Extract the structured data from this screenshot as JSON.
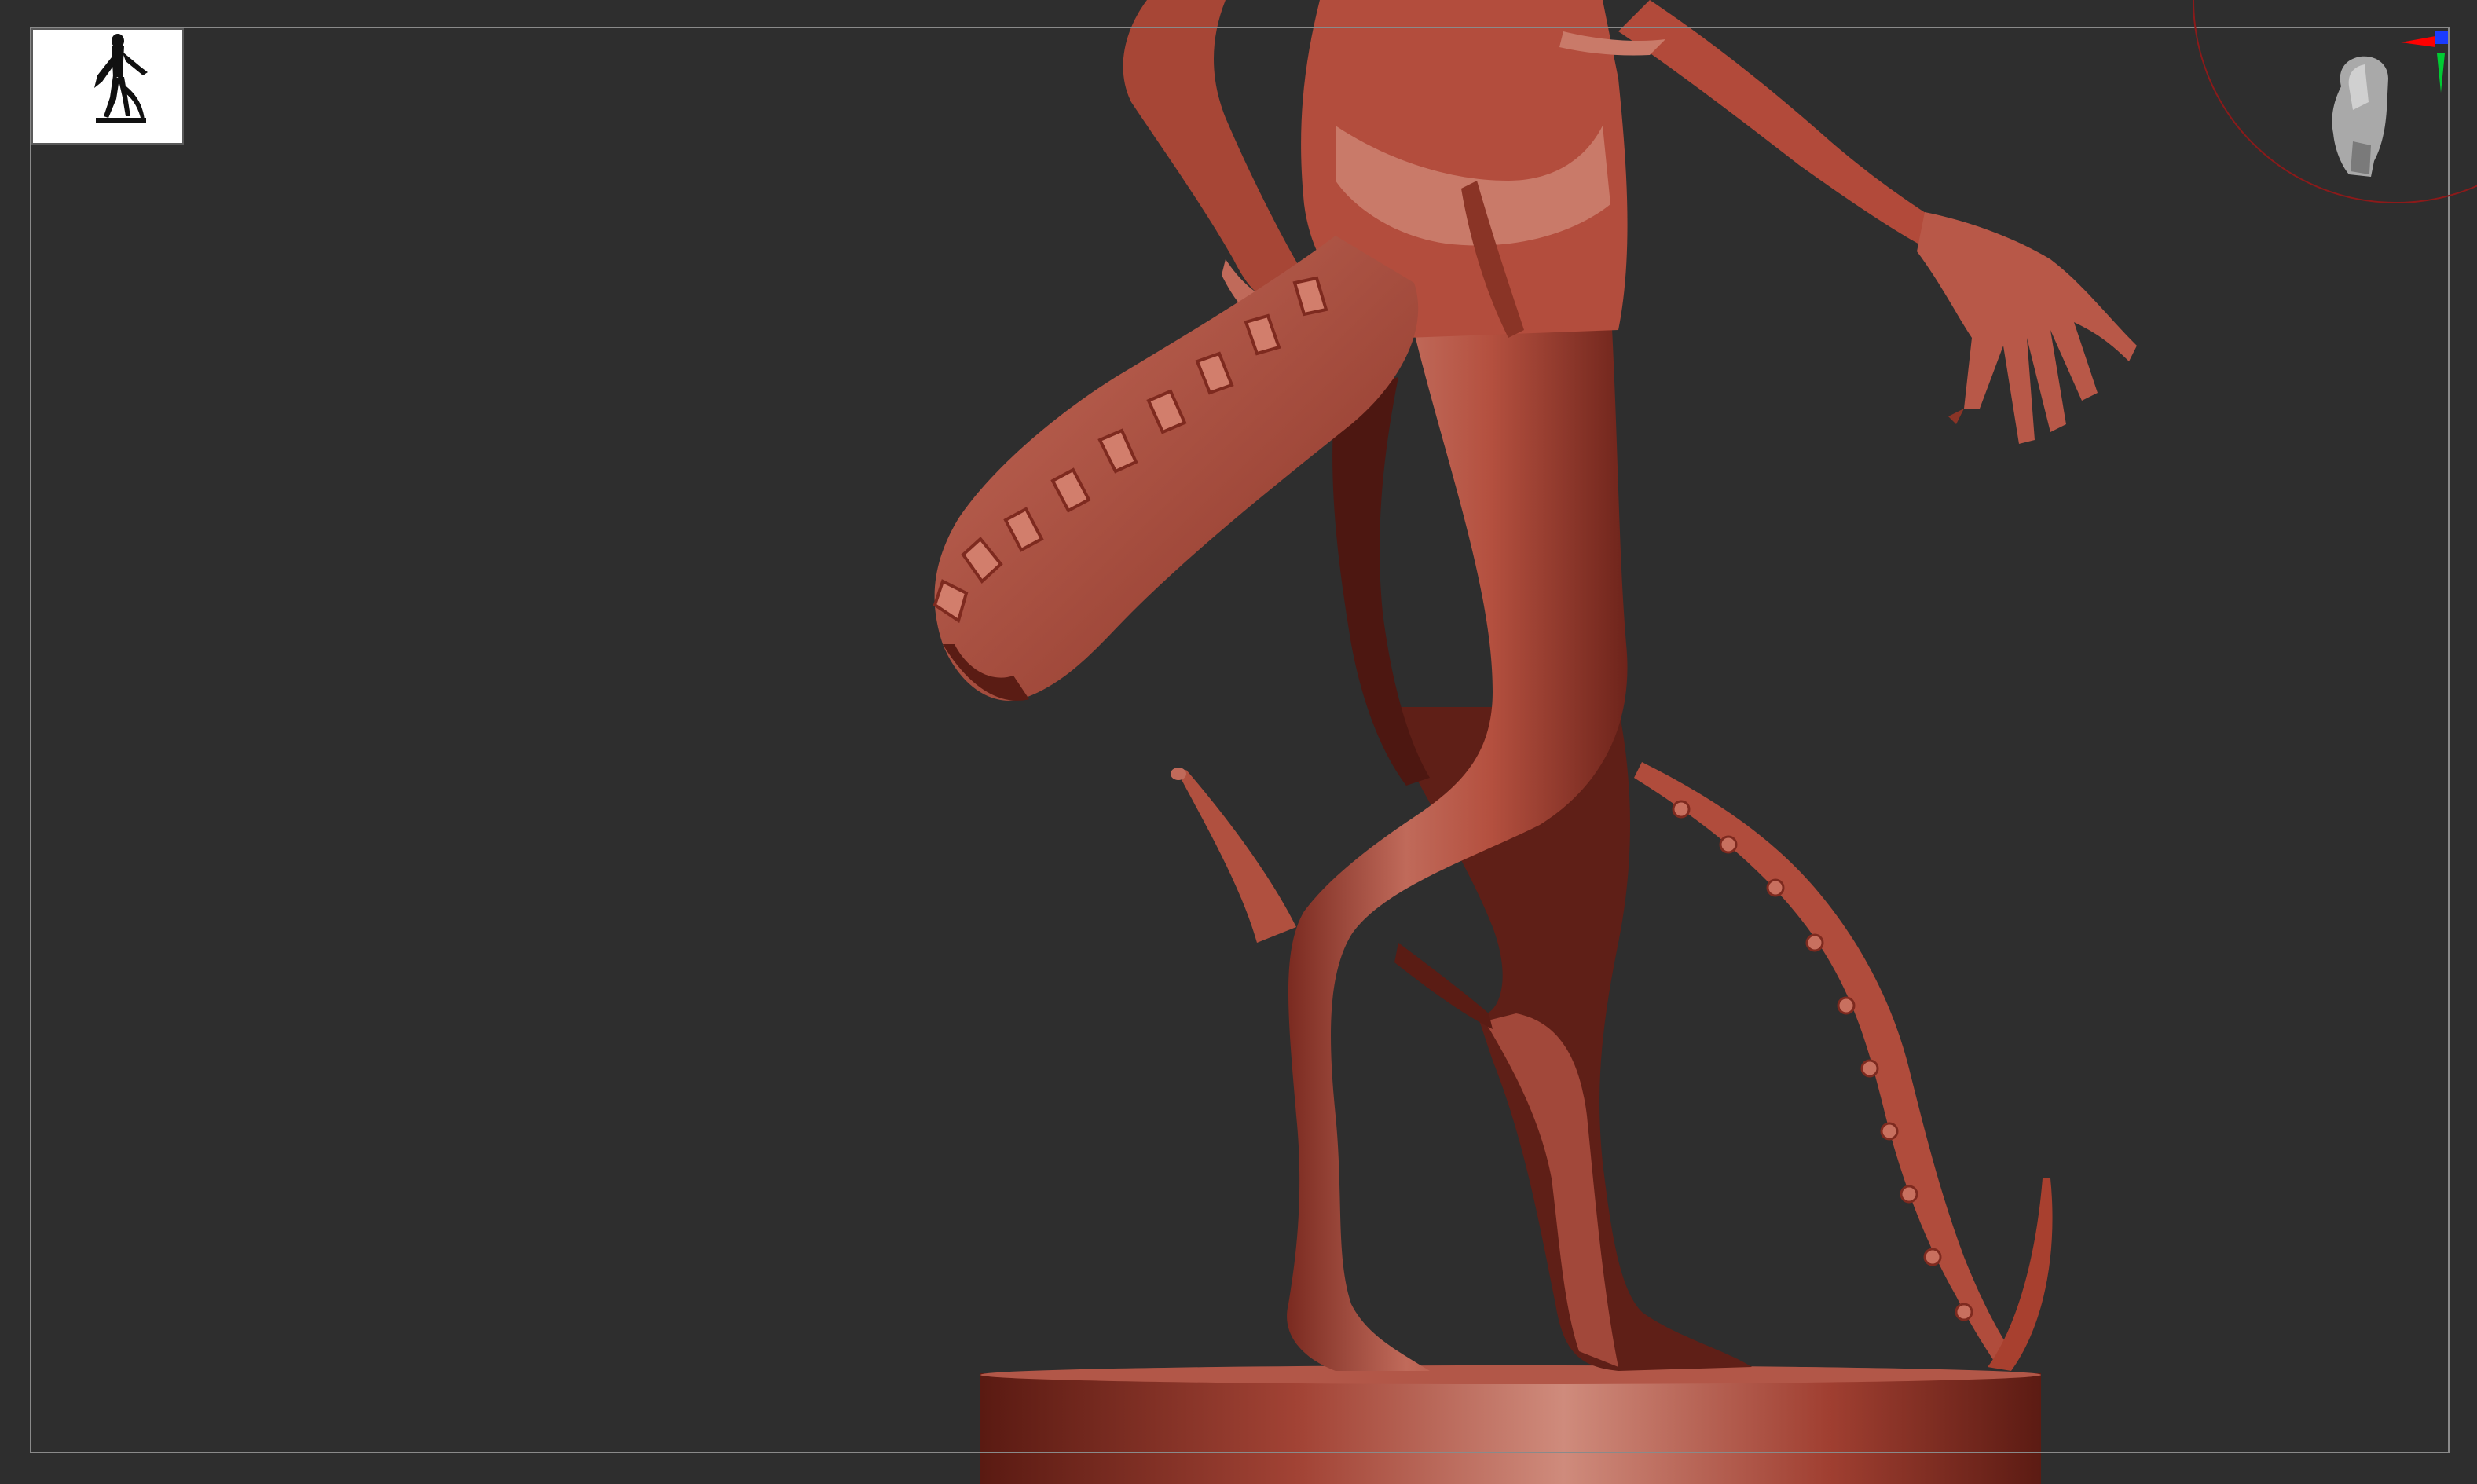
{
  "viewport": {
    "background": "#2e2e2e",
    "frame_color": "#8a8a8a",
    "model_color": "#b24a3c",
    "model_shadow": "#5e1d16",
    "model_highlight": "#d88b7c"
  },
  "thumbnail": {
    "icon": "model-silhouette-icon",
    "background": "#ffffff"
  },
  "navigator": {
    "icon": "head-orientation-icon",
    "axis_colors": [
      "#ff0000",
      "#00cc33",
      "#1a3cff"
    ],
    "ring_color": "#8b1a1a"
  }
}
